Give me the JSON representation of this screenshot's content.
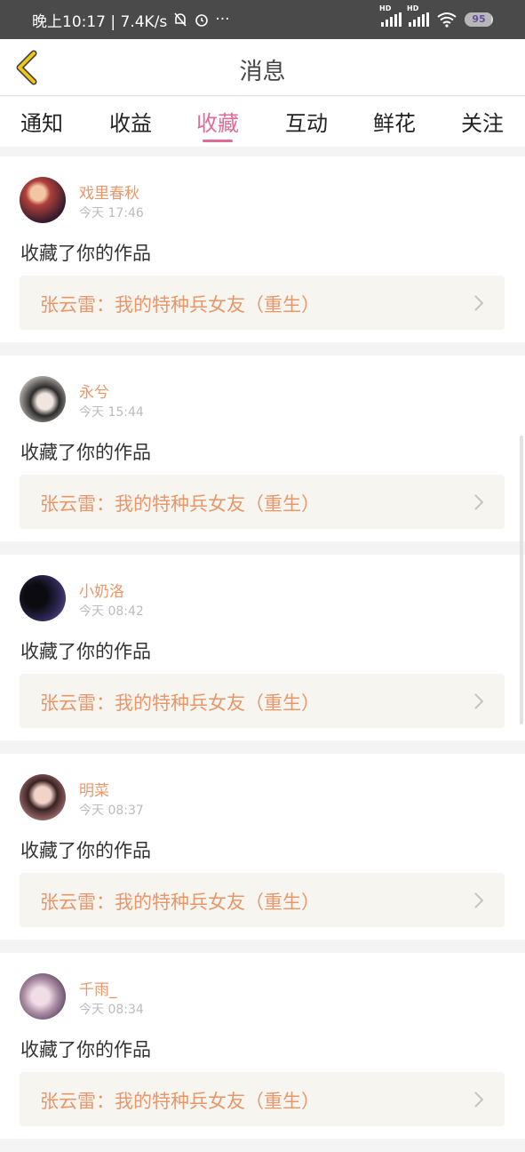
{
  "status_bar": {
    "time_text": "晚上10:17 | 7.4K/s",
    "more_text": "···",
    "sim1_label": "HD",
    "sim2_label": "HD",
    "battery_level": "95"
  },
  "header": {
    "title": "消息"
  },
  "tabs": [
    {
      "label": "通知"
    },
    {
      "label": "收益"
    },
    {
      "label": "收藏"
    },
    {
      "label": "互动"
    },
    {
      "label": "鲜花"
    },
    {
      "label": "关注"
    }
  ],
  "active_tab": "收藏",
  "colors": {
    "accent": "#e16b97",
    "name": "#e9976a",
    "back_icon": "#f0c419"
  },
  "messages": [
    {
      "user": "戏里春秋",
      "time": "今天 17:46",
      "action": "收藏了你的作品",
      "work": "张云雷：我的特种兵女友（重生）"
    },
    {
      "user": "永兮",
      "time": "今天 15:44",
      "action": "收藏了你的作品",
      "work": "张云雷：我的特种兵女友（重生）"
    },
    {
      "user": "小奶洛",
      "time": "今天 08:42",
      "action": "收藏了你的作品",
      "work": "张云雷：我的特种兵女友（重生）"
    },
    {
      "user": "明菜",
      "time": "今天 08:37",
      "action": "收藏了你的作品",
      "work": "张云雷：我的特种兵女友（重生）"
    },
    {
      "user": "千雨_",
      "time": "今天 08:34",
      "action": "收藏了你的作品",
      "work": "张云雷：我的特种兵女友（重生）"
    }
  ]
}
